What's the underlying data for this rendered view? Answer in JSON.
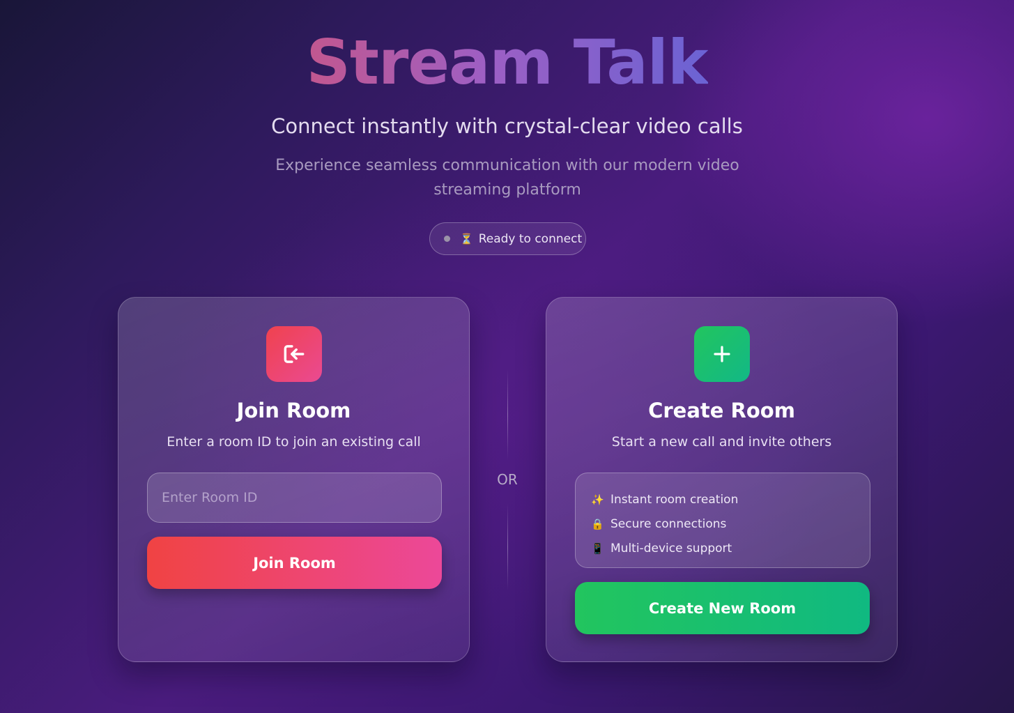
{
  "header": {
    "title": "Stream Talk",
    "subtitle": "Connect instantly with crystal-clear video calls",
    "description": "Experience seamless communication with our modern video streaming platform"
  },
  "status": {
    "icon": "hourglass-icon",
    "text": "Ready to connect",
    "dot_color": "#9b93a8"
  },
  "join_card": {
    "icon": "enter-room-icon",
    "title": "Join Room",
    "subtitle": "Enter a room ID to join an existing call",
    "input_placeholder": "Enter Room ID",
    "input_value": "",
    "button_label": "Join Room",
    "accent": "#f04343"
  },
  "divider": {
    "label": "OR"
  },
  "create_card": {
    "icon": "plus-icon",
    "title": "Create Room",
    "subtitle": "Start a new call and invite others",
    "features": [
      {
        "icon": "sparkles-icon",
        "glyph": "✨",
        "text": "Instant room creation"
      },
      {
        "icon": "lock-icon",
        "glyph": "🔒",
        "text": "Secure connections"
      },
      {
        "icon": "mobile-devices-icon",
        "glyph": "📱",
        "text": "Multi-device support"
      }
    ],
    "button_label": "Create New Room",
    "accent": "#22c55e"
  }
}
